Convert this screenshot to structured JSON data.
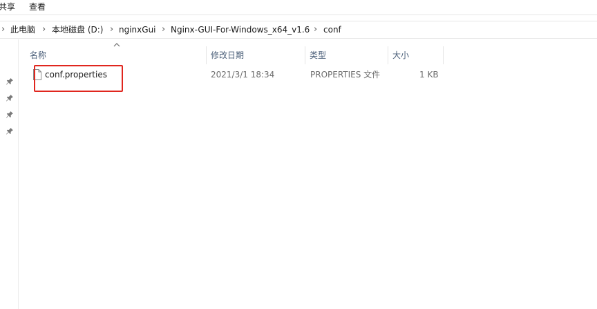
{
  "ribbon": {
    "tabs": [
      {
        "label": "共享"
      },
      {
        "label": "查看"
      }
    ]
  },
  "address_bar": {
    "crumbs": [
      {
        "label": "此电脑"
      },
      {
        "label": "本地磁盘 (D:)"
      },
      {
        "label": "nginxGui"
      },
      {
        "label": "Nginx-GUI-For-Windows_x64_v1.6"
      },
      {
        "label": "conf"
      }
    ]
  },
  "file_list": {
    "columns": {
      "name": "名称",
      "modified": "修改日期",
      "type": "类型",
      "size": "大小"
    },
    "sorted_by": "name",
    "rows": [
      {
        "name": "conf.properties",
        "modified": "2021/3/1 18:34",
        "type": "PROPERTIES 文件",
        "size": "1 KB",
        "icon": "document-icon"
      }
    ]
  },
  "nav": {
    "pins": [
      "pin-icon",
      "pin-icon",
      "pin-icon",
      "pin-icon"
    ]
  },
  "annotation": {
    "highlight_color": "#e0261e",
    "target": "conf.properties"
  },
  "colors": {
    "column_header": "#4c607a",
    "secondary_text": "#6d6d6d"
  }
}
